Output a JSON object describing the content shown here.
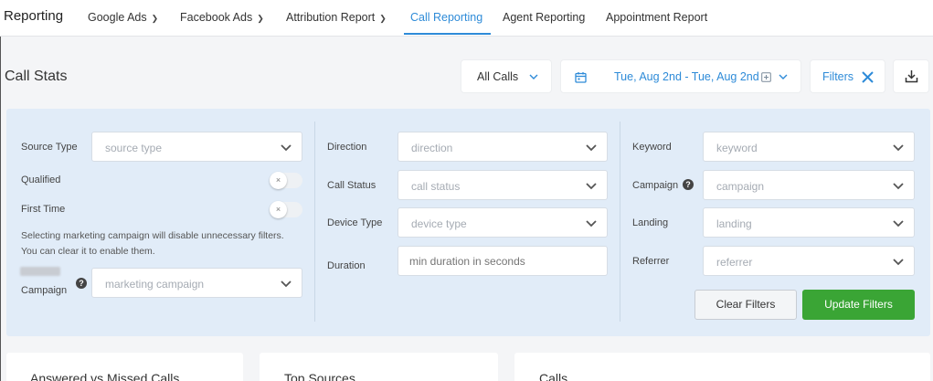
{
  "nav": {
    "brand": "Reporting",
    "items": [
      {
        "label": "Google Ads",
        "dropdown": true
      },
      {
        "label": "Facebook Ads",
        "dropdown": true
      },
      {
        "label": "Attribution Report",
        "dropdown": true
      },
      {
        "label": "Call Reporting",
        "active": true
      },
      {
        "label": "Agent Reporting"
      },
      {
        "label": "Appointment Report"
      }
    ]
  },
  "header": {
    "title": "Call Stats",
    "call_filter": "All Calls",
    "date_range": "Tue, Aug 2nd - Tue, Aug 2nd",
    "filters_label": "Filters"
  },
  "filters": {
    "col1": {
      "source_type": {
        "label": "Source Type",
        "placeholder": "source type"
      },
      "qualified": {
        "label": "Qualified",
        "on": false
      },
      "first_time": {
        "label": "First Time",
        "on": false
      },
      "note_line1": "Selecting marketing campaign will disable unnecessary filters.",
      "note_line2": "You can clear it to enable them.",
      "campaign": {
        "label": "Campaign",
        "placeholder": "marketing campaign"
      }
    },
    "col2": {
      "direction": {
        "label": "Direction",
        "placeholder": "direction"
      },
      "call_status": {
        "label": "Call Status",
        "placeholder": "call status"
      },
      "device_type": {
        "label": "Device Type",
        "placeholder": "device type"
      },
      "duration": {
        "label": "Duration",
        "placeholder": "min duration in seconds"
      }
    },
    "col3": {
      "keyword": {
        "label": "Keyword",
        "placeholder": "keyword"
      },
      "campaign": {
        "label": "Campaign",
        "placeholder": "campaign"
      },
      "landing": {
        "label": "Landing",
        "placeholder": "landing"
      },
      "referrer": {
        "label": "Referrer",
        "placeholder": "referrer"
      }
    },
    "clear_label": "Clear Filters",
    "update_label": "Update Filters"
  },
  "cards": {
    "answered_missed": "Answered vs Missed Calls",
    "top_sources": "Top Sources",
    "calls": "Calls"
  },
  "colors": {
    "accent": "#2e8bd8",
    "panel_bg": "#e1ecf8",
    "update_button": "#3aa535"
  }
}
